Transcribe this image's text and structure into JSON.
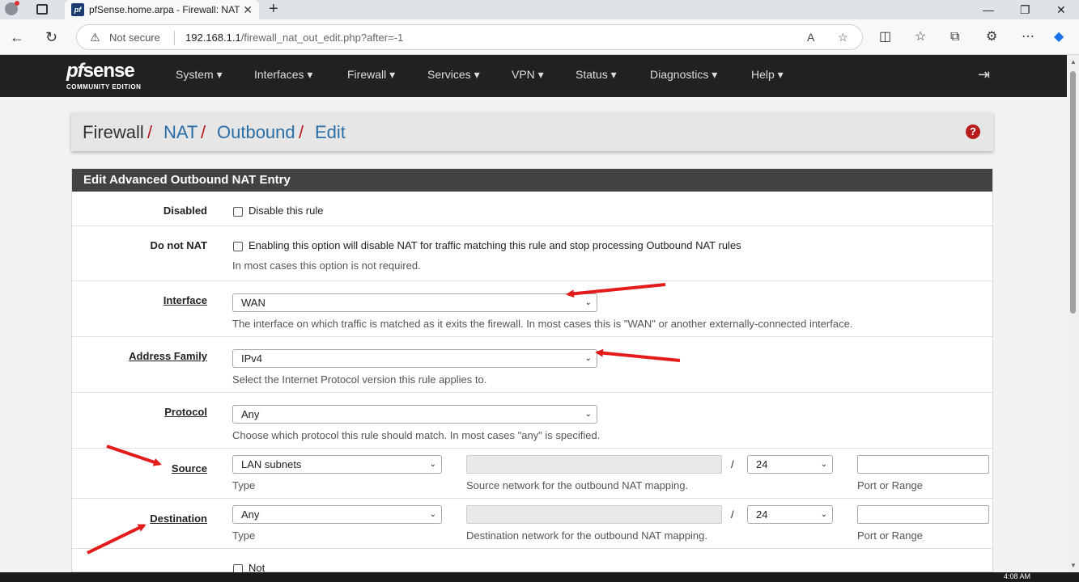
{
  "browser": {
    "tab_title": "pfSense.home.arpa - Firewall: NAT",
    "favicon": "pf",
    "security_label": "Not secure",
    "url_host": "192.168.1.1",
    "url_path": "/firewall_nat_out_edit.php?after=-1"
  },
  "nav": {
    "logo_pf": "pf",
    "logo_sense": "sense",
    "logo_edition": "COMMUNITY EDITION",
    "items": [
      "System ▾",
      "Interfaces ▾",
      "Firewall ▾",
      "Services ▾",
      "VPN ▾",
      "Status ▾",
      "Diagnostics ▾",
      "Help ▾"
    ]
  },
  "breadcrumb": {
    "root": "Firewall",
    "items": [
      "NAT",
      "Outbound",
      "Edit"
    ],
    "separator": "/",
    "help_icon": "?"
  },
  "panel": {
    "title": "Edit Advanced Outbound NAT Entry",
    "disabled": {
      "label": "Disabled",
      "checkbox_text": "Disable this rule"
    },
    "donotnat": {
      "label": "Do not NAT",
      "checkbox_text": "Enabling this option will disable NAT for traffic matching this rule and stop processing Outbound NAT rules",
      "hint": "In most cases this option is not required."
    },
    "interface": {
      "label": "Interface",
      "value": "WAN",
      "hint": "The interface on which traffic is matched as it exits the firewall. In most cases this is \"WAN\" or another externally-connected interface."
    },
    "address_family": {
      "label": "Address Family",
      "value": "IPv4",
      "hint": "Select the Internet Protocol version this rule applies to."
    },
    "protocol": {
      "label": "Protocol",
      "value": "Any",
      "hint": "Choose which protocol this rule should match. In most cases \"any\" is specified."
    },
    "source": {
      "label": "Source",
      "type_value": "LAN subnets",
      "type_hint": "Type",
      "mask": "24",
      "slash": "/",
      "network_hint": "Source network for the outbound NAT mapping.",
      "port_hint": "Port or Range"
    },
    "destination": {
      "label": "Destination",
      "type_value": "Any",
      "type_hint": "Type",
      "mask": "24",
      "slash": "/",
      "network_hint": "Destination network for the outbound NAT mapping.",
      "port_hint": "Port or Range"
    },
    "not": {
      "checkbox_text": "Not"
    }
  },
  "taskbar": {
    "clock": "4:08 AM"
  },
  "colors": {
    "nav_bg": "#212121",
    "link": "#2a6ea8",
    "accent_red": "#b71c1c",
    "arrow": "#e31b1b"
  }
}
